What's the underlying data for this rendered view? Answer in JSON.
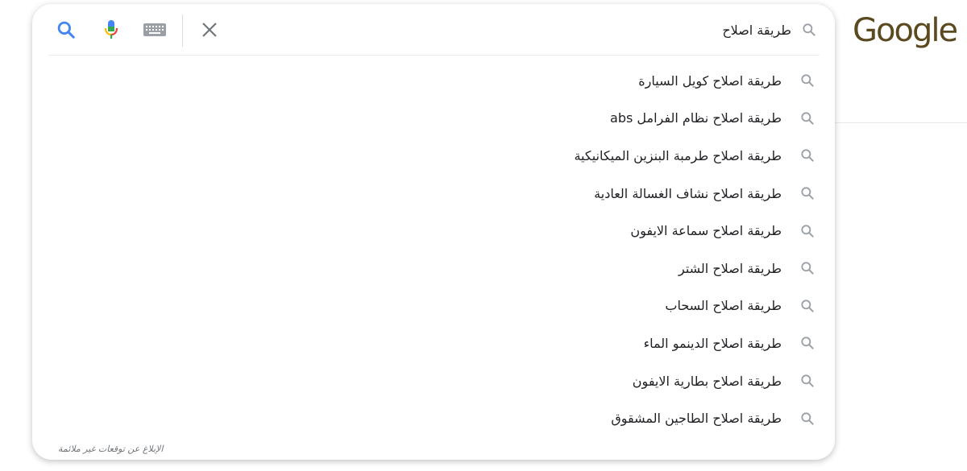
{
  "logo": {
    "text": "Google"
  },
  "search": {
    "query": "طريقة اصلاح",
    "placeholder": ""
  },
  "icons": {
    "query_search": "search-icon",
    "lens": "search-icon",
    "mic": "mic-icon",
    "keyboard": "keyboard-icon",
    "clear": "close-icon",
    "suggestion": "search-icon"
  },
  "colors": {
    "google_blue": "#4285f4",
    "google_red": "#ea4335",
    "google_yellow": "#fbbc04",
    "google_green": "#34a853",
    "icon_gray": "#9aa0a6",
    "text": "#202124",
    "logo": "#5b4a1f"
  },
  "suggestions": [
    "طريقة اصلاح كويل السيارة",
    "طريقة اصلاح نظام الفرامل abs",
    "طريقة اصلاح طرمبة البنزين الميكانيكية",
    "طريقة اصلاح نشاف الغسالة العادية",
    "طريقة اصلاح سماعة الايفون",
    "طريقة اصلاح الشتر",
    "طريقة اصلاح السحاب",
    "طريقة اصلاح الدينمو الماء",
    "طريقة اصلاح بطارية الايفون",
    "طريقة اصلاح الطاجين المشقوق"
  ],
  "footer": {
    "report_text": "الإبلاغ عن توقعات غير ملائمة"
  }
}
